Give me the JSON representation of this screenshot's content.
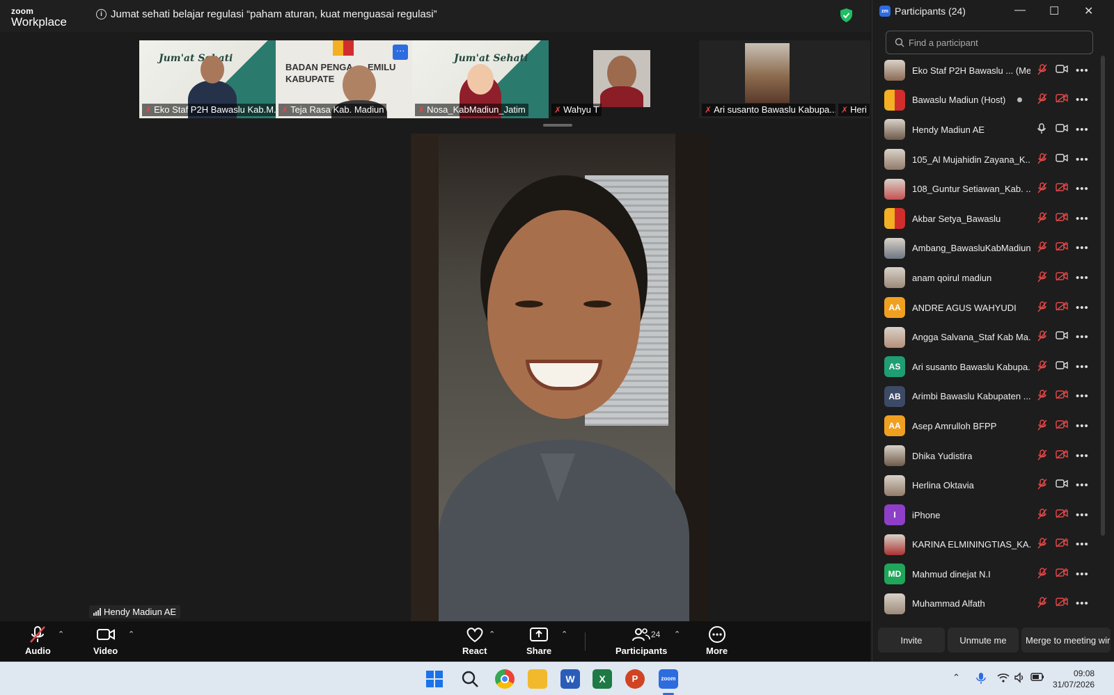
{
  "app": {
    "logo_top": "zoom",
    "logo_bottom": "Workplace"
  },
  "meeting": {
    "topic": "Jumat sehati belajar regulasi “paham aturan, kuat menguasai regulasi”"
  },
  "gallery": {
    "tiles": [
      {
        "name": "Eko Staf P2H Bawaslu Kab.M...",
        "banner": "Jum'at Sehati"
      },
      {
        "name": "Teja Rasa Kab. Madiun",
        "banner": "BADAN PENGA      EMILU\nKABUPATE         UN"
      },
      {
        "name": "Nosa_KabMadiun_Jatim",
        "banner": "Jum'at Sehati"
      },
      {
        "name": "Wahyu T"
      },
      {
        "name": "Ari susanto Bawaslu Kabupa..."
      },
      {
        "name": "Heri"
      }
    ],
    "more_label": "···"
  },
  "active_speaker": {
    "name": "Hendy Madiun AE"
  },
  "toolbar": {
    "audio": "Audio",
    "video": "Video",
    "react": "React",
    "share": "Share",
    "participants": "Participants",
    "participants_count": "24",
    "more": "More"
  },
  "participants_panel": {
    "title": "Participants (24)",
    "badge": "zm",
    "search_placeholder": "Find a participant",
    "items": [
      {
        "name": "Eko Staf P2H Bawaslu ... (Me)",
        "avatar": "photo",
        "mic": "off",
        "cam": "on"
      },
      {
        "name": "Bawaslu Madiun (Host)",
        "avatar": "logo",
        "mic": "off",
        "cam": "off"
      },
      {
        "name": "Hendy Madiun AE",
        "avatar": "photo",
        "mic": "on",
        "cam": "on"
      },
      {
        "name": "105_Al Mujahidin Zayana_K...",
        "avatar": "photo",
        "mic": "off",
        "cam": "on"
      },
      {
        "name": "108_Guntur Setiawan_Kab. ...",
        "avatar": "photo",
        "mic": "off",
        "cam": "off"
      },
      {
        "name": "Akbar Setya_Bawaslu",
        "avatar": "logo",
        "mic": "off",
        "cam": "off"
      },
      {
        "name": "Ambang_BawasluKabMadiun",
        "avatar": "photo",
        "mic": "off",
        "cam": "off"
      },
      {
        "name": "anam qoirul madiun",
        "avatar": "photo",
        "mic": "off",
        "cam": "off"
      },
      {
        "name": "ANDRE AGUS WAHYUDI",
        "avatar": "AA",
        "avatar_color": "#f0a020",
        "mic": "off",
        "cam": "off"
      },
      {
        "name": "Angga Salvana_Staf Kab Ma...",
        "avatar": "photo",
        "mic": "off",
        "cam": "on"
      },
      {
        "name": "Ari susanto Bawaslu Kabupa...",
        "avatar": "AS",
        "avatar_color": "#1e9e72",
        "mic": "off",
        "cam": "on"
      },
      {
        "name": "Arimbi Bawaslu Kabupaten ...",
        "avatar": "AB",
        "avatar_color": "#3d4a66",
        "mic": "off",
        "cam": "off"
      },
      {
        "name": "Asep Amrulloh BFPP",
        "avatar": "AA",
        "avatar_color": "#f0a020",
        "mic": "off",
        "cam": "off"
      },
      {
        "name": "Dhika Yudistira",
        "avatar": "photo",
        "mic": "off",
        "cam": "off"
      },
      {
        "name": "Herlina Oktavia",
        "avatar": "photo",
        "mic": "off",
        "cam": "on"
      },
      {
        "name": "iPhone",
        "avatar": "I",
        "avatar_color": "#8e3fc7",
        "mic": "off",
        "cam": "off"
      },
      {
        "name": "KARINA ELMININGTIAS_KA...",
        "avatar": "photo",
        "mic": "off",
        "cam": "off"
      },
      {
        "name": "Mahmud dinejat N.I",
        "avatar": "MD",
        "avatar_color": "#1fa65a",
        "mic": "off",
        "cam": "off"
      },
      {
        "name": "Muhammad Alfath",
        "avatar": "photo",
        "mic": "off",
        "cam": "off"
      }
    ],
    "buttons": {
      "invite": "Invite",
      "unmute": "Unmute me",
      "merge": "Merge to meeting wir"
    }
  },
  "taskbar": {
    "time": "09:08",
    "date": "31/07/2026"
  },
  "colors": {
    "accent": "#2d6cdf",
    "mic_off": "#e54848",
    "panel_bg": "#1d1d1d",
    "toolbar_bg": "#111111"
  }
}
